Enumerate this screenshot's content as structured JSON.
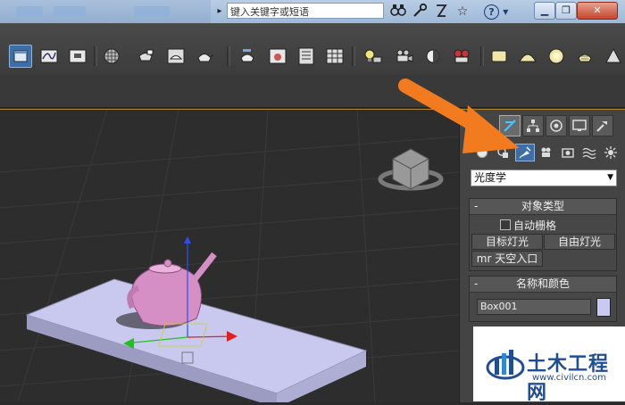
{
  "titlebar": {
    "search_placeholder": "键入关键字或短语",
    "help_label": "?",
    "help_dropdown": "▾",
    "min_label": "▁",
    "restore_label": "❐",
    "close_label": "✕",
    "expand_label": "▸"
  },
  "icons": {
    "binoculars": "⚲",
    "tools": "✂",
    "star": "☆",
    "search_glyph": "🔍"
  },
  "command_panel": {
    "category_value": "光度学",
    "object_type": {
      "title": "对象类型",
      "autogrid_label": "自动栅格",
      "buttons": [
        "目标灯光",
        "自由灯光",
        "mr 天空入口"
      ]
    },
    "name_color": {
      "title": "名称和颜色",
      "name_value": "Box001",
      "swatch_color": "#c9c9f4"
    },
    "collapse_symbol": "-"
  },
  "watermark": {
    "title": "土木工程网",
    "url": "www.civilcn.com"
  },
  "colors": {
    "accent_blue": "#3e6ea8",
    "arrow_orange": "#f27a1f",
    "viewport_bg": "#2d2d2d",
    "teapot_pink": "#d58fc4",
    "box_lavender": "#c9c9f0"
  }
}
